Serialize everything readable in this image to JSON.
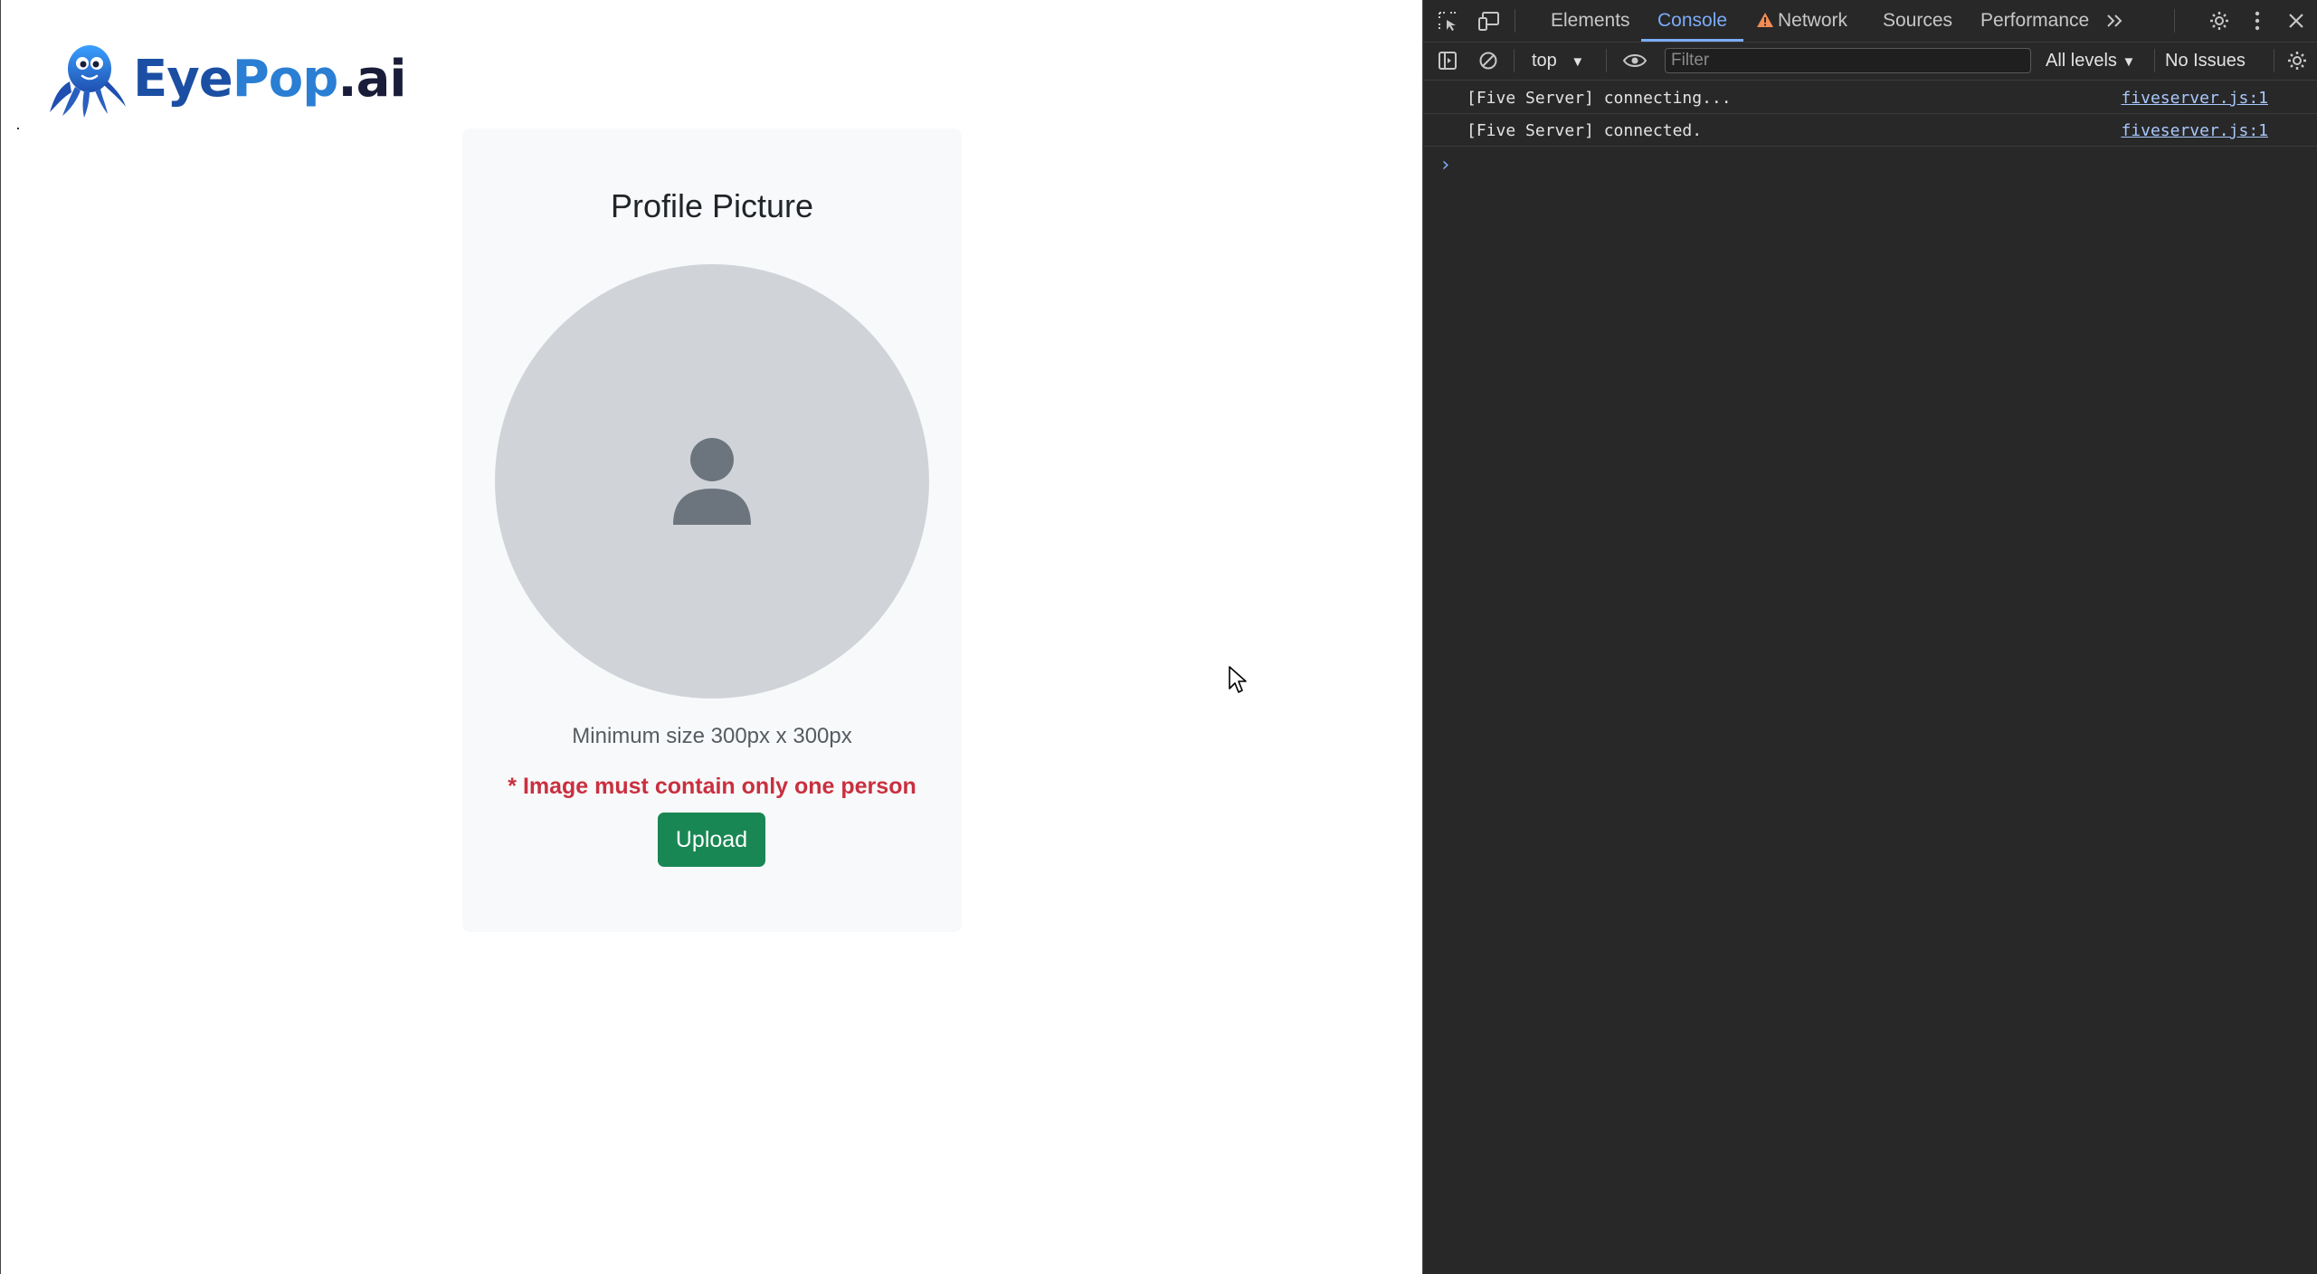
{
  "page": {
    "logo": {
      "eye": "Eye",
      "pop": "Pop",
      "ai": ".ai"
    },
    "card": {
      "title": "Profile Picture",
      "min_size": "Minimum size 300px x 300px",
      "warning": "* Image must contain only one person",
      "upload_label": "Upload"
    },
    "colors": {
      "upload_button": "#198754",
      "warning_text": "#c9303f",
      "avatar_bg": "#d0d4d9",
      "avatar_icon": "#6c757d"
    }
  },
  "devtools": {
    "tabs": [
      {
        "label": "Elements"
      },
      {
        "label": "Console"
      },
      {
        "label": "Network"
      },
      {
        "label": "Sources"
      },
      {
        "label": "Performance"
      }
    ],
    "active_tab": "Console",
    "toolbar": {
      "context": "top",
      "filter_placeholder": "Filter",
      "levels": "All levels",
      "issues": "No Issues"
    },
    "console": [
      {
        "message": "[Five Server] connecting...",
        "source": "fiveserver.js:1"
      },
      {
        "message": "[Five Server] connected.",
        "source": "fiveserver.js:1"
      }
    ]
  }
}
